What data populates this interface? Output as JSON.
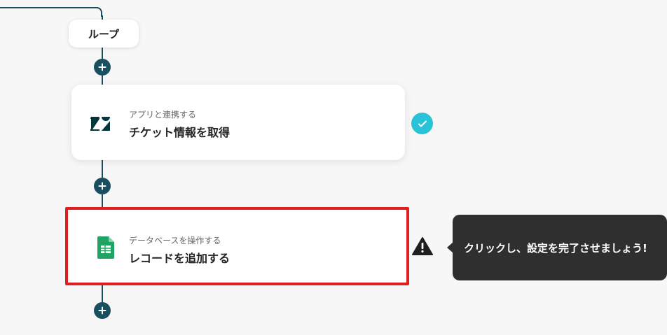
{
  "flow": {
    "loop_label": "ループ",
    "steps": [
      {
        "subtitle": "アプリと連携する",
        "title": "チケット情報を取得",
        "app_icon": "zendesk-logo-icon",
        "status": "completed"
      },
      {
        "subtitle": "データベースを操作する",
        "title": "レコードを追加する",
        "app_icon": "google-sheets-icon",
        "status": "incomplete"
      }
    ]
  },
  "tooltip": {
    "text": "クリックし、設定を完了させましょう!"
  },
  "colors": {
    "connector": "#1a4f5f",
    "check": "#28c3d6",
    "highlight": "#e02020",
    "tooltip_bg": "#2f2f2f"
  }
}
